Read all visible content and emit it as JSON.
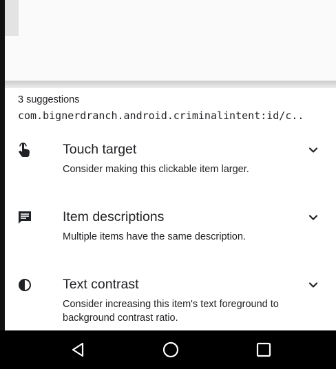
{
  "bottom_sheet": {
    "suggestion_count": "3 suggestions",
    "element_id": "com.bignerdranch.android.criminalintent:id/c.."
  },
  "suggestions": [
    {
      "icon": "touch-target-icon",
      "title": "Touch target",
      "description": "Consider making this clickable item larger."
    },
    {
      "icon": "item-descriptions-icon",
      "title": "Item descriptions",
      "description": "Multiple items have the same description."
    },
    {
      "icon": "text-contrast-icon",
      "title": "Text contrast",
      "description": "Consider increasing this item's text foreground to background contrast ratio."
    }
  ],
  "navigation_bar": {
    "buttons": [
      "back",
      "home",
      "recents"
    ]
  }
}
